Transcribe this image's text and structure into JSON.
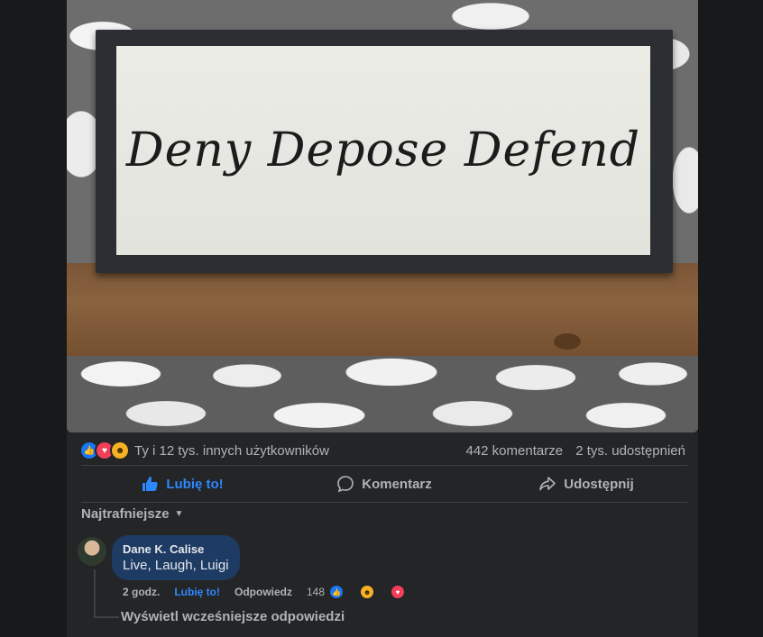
{
  "photo": {
    "sign_text": "Deny Depose Defend"
  },
  "stats": {
    "reactions": [
      "like",
      "love",
      "haha"
    ],
    "reactions_text": "Ty i 12 tys. innych użytkowników",
    "comments": "442 komentarze",
    "shares": "2 tys. udostępnień"
  },
  "actions": {
    "like": "Lubię to!",
    "comment": "Komentarz",
    "share": "Udostępnij"
  },
  "comments": {
    "sort_label": "Najtrafniejsze",
    "items": [
      {
        "author": "Dane K. Calise",
        "text": "Live, Laugh, Luigi",
        "time": "2 godz.",
        "like_label": "Lubię to!",
        "reply_label": "Odpowiedz",
        "reaction_count": "148",
        "reactions": [
          "like",
          "haha",
          "love"
        ]
      }
    ],
    "view_previous": "Wyświetl wcześniejsze odpowiedzi"
  },
  "colors": {
    "accent": "#2d88ff",
    "bubble": "#1d3b63",
    "card": "#242526",
    "page": "#18191a"
  }
}
